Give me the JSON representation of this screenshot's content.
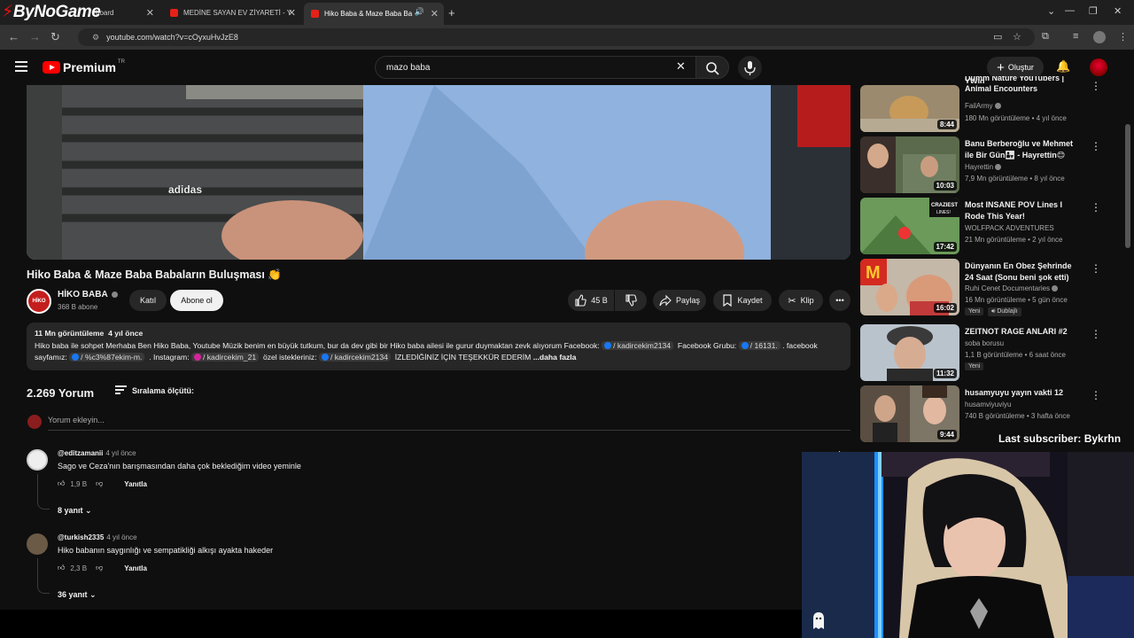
{
  "overlay": {
    "logo_text": "ByNoGame",
    "last_subscriber": "Last subscriber: Bykrhn"
  },
  "browser": {
    "tabs": [
      {
        "label": "board",
        "active": false
      },
      {
        "label": "MEDİNE SAYAN EV ZİYARETİ - Y",
        "active": false
      },
      {
        "label": "Hiko Baba & Maze Baba Ba",
        "active": true
      }
    ],
    "new_tab": "+",
    "url": "youtube.com/watch?v=cOyxuHvJzE8"
  },
  "header": {
    "logo": "Premium",
    "region": "TR",
    "search_value": "mazo baba",
    "create_label": "Oluştur"
  },
  "video": {
    "title": "Hiko Baba & Maze Baba Babaların Buluşması 👏",
    "channel_name": "HİKO BABA",
    "channel_avatar_text": "HİKO BABA",
    "subscribers": "368 B abone",
    "join_label": "Katıl",
    "subscribe_label": "Abone ol",
    "likes": "45 B",
    "share_label": "Paylaş",
    "save_label": "Kaydet",
    "clip_label": "Klip"
  },
  "description": {
    "views": "11 Mn görüntüleme",
    "age": "4 yıl önce",
    "text1": "Hiko baba ile sohpet Merhaba Ben Hiko Baba, Youtube Müzik benim en büyük tutkum, bur da dev gibi bir Hiko baba ailesi ile gurur duymaktan zevk alıyorum Facebook:",
    "tag1": "/ kadircekim2134",
    "text2": "Facebook Grubu:",
    "tag2": "/ 16131.",
    "text3": ". facebook sayfamız:",
    "tag3": "/ %c3%87ekim-m.",
    "text4": ". Instagram:",
    "tag4": "/ kadircekim_21",
    "text5": "özel istekleriniz:",
    "tag5": "/ kadircekim2134",
    "text6": "İZLEDİĞİNİZ İÇİN TEŞEKKÜR EDERİM",
    "more": "...daha fazla"
  },
  "comments": {
    "count": "2.269 Yorum",
    "sort_label": "Sıralama ölçütü:",
    "add_placeholder": "Yorum ekleyin...",
    "reply_label": "Yanıtla",
    "items": [
      {
        "handle": "@editzamanii",
        "age": "4 yıl önce",
        "text": "Sago ve Ceza'nın barışmasından daha çok beklediğim video yeminle",
        "likes": "1,9 B",
        "replies": "8 yanıt"
      },
      {
        "handle": "@turkish2335",
        "age": "4 yıl önce",
        "text": "Hiko babanın saygınlığı ve sempatikliği alkışı ayakta hakeder",
        "likes": "2,3 B",
        "replies": "36 yanıt"
      }
    ]
  },
  "recommendations": [
    {
      "title": "Animal Encounters",
      "title_top": "Dumm Nature YouTubers | YWld",
      "channel": "FailArmy",
      "meta": "180 Mn görüntüleme • 4 yıl önce",
      "duration": "8:44",
      "badge": ""
    },
    {
      "title": "Banu Berberoğlu ve Mehmet ile Bir Gün👨‍👧 - Hayrettin😊",
      "channel": "Hayrettin",
      "meta": "7,9 Mn görüntüleme • 8 yıl önce",
      "duration": "10:03",
      "badge": ""
    },
    {
      "title": "Most INSANE POV Lines I Rode This Year!",
      "channel": "WOLFPACK ADVENTURES",
      "meta": "21 Mn görüntüleme • 2 yıl önce",
      "duration": "17:42",
      "badge": ""
    },
    {
      "title": "Dünyanın En Obez Şehrinde 24 Saat (Sonu beni şok etti)",
      "channel": "Ruhi Cenet Documentaries",
      "meta": "16 Mn görüntüleme • 5 gün önce",
      "duration": "16:02",
      "badge": "Yeni",
      "badge2": "Dublajlı"
    },
    {
      "title": "ZEITNOT RAGE ANLARI #2",
      "channel": "soba borusu",
      "meta": "1,1 B görüntüleme • 6 saat önce",
      "duration": "11:32",
      "badge": "Yeni"
    },
    {
      "title": "husamyuyu yayın vakti 12",
      "channel": "husamviyuviyu",
      "meta": "740 B görüntüleme • 3 hafta önce",
      "duration": "9:44",
      "badge": ""
    }
  ],
  "colors": {
    "background": "#0f0f0f",
    "surface": "#272727",
    "brand_red": "#ff0000",
    "text": "#f1f1f1",
    "muted": "#aaaaaa"
  }
}
